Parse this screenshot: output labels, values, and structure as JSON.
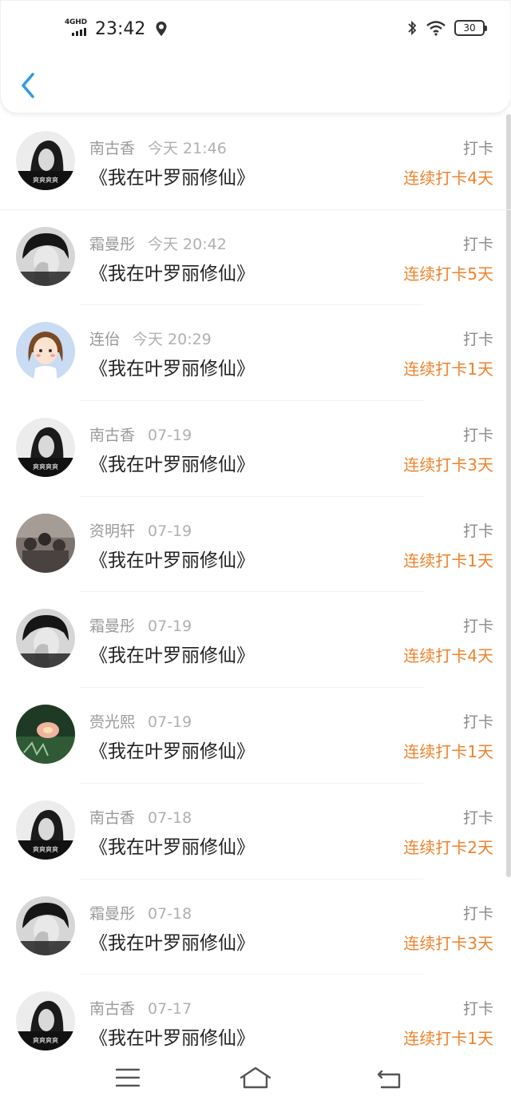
{
  "status": {
    "network": "4GHD",
    "time": "23:42",
    "battery": "30"
  },
  "header": {
    "back_icon": "chevron-left-icon"
  },
  "colors": {
    "accent_orange": "#f0822a",
    "back_blue": "#2f9be8",
    "muted_text": "#9a9a9a"
  },
  "entries": [
    {
      "name": "南古香",
      "time": "今天 21:46",
      "book": "《我在叶罗丽修仙》",
      "action": "打卡",
      "streak": "连续打卡4天"
    },
    {
      "name": "霜曼彤",
      "time": "今天 20:42",
      "book": "《我在叶罗丽修仙》",
      "action": "打卡",
      "streak": "连续打卡5天"
    },
    {
      "name": "连佁",
      "time": "今天 20:29",
      "book": "《我在叶罗丽修仙》",
      "action": "打卡",
      "streak": "连续打卡1天"
    },
    {
      "name": "南古香",
      "time": "07-19",
      "book": "《我在叶罗丽修仙》",
      "action": "打卡",
      "streak": "连续打卡3天"
    },
    {
      "name": "资明轩",
      "time": "07-19",
      "book": "《我在叶罗丽修仙》",
      "action": "打卡",
      "streak": "连续打卡1天"
    },
    {
      "name": "霜曼彤",
      "time": "07-19",
      "book": "《我在叶罗丽修仙》",
      "action": "打卡",
      "streak": "连续打卡4天"
    },
    {
      "name": "赍光熙",
      "time": "07-19",
      "book": "《我在叶罗丽修仙》",
      "action": "打卡",
      "streak": "连续打卡1天"
    },
    {
      "name": "南古香",
      "time": "07-18",
      "book": "《我在叶罗丽修仙》",
      "action": "打卡",
      "streak": "连续打卡2天"
    },
    {
      "name": "霜曼彤",
      "time": "07-18",
      "book": "《我在叶罗丽修仙》",
      "action": "打卡",
      "streak": "连续打卡3天"
    },
    {
      "name": "南古香",
      "time": "07-17",
      "book": "《我在叶罗丽修仙》",
      "action": "打卡",
      "streak": "连续打卡1天"
    }
  ],
  "nav": {
    "menu_icon": "menu-icon",
    "home_icon": "home-icon",
    "back_icon": "back-icon"
  }
}
